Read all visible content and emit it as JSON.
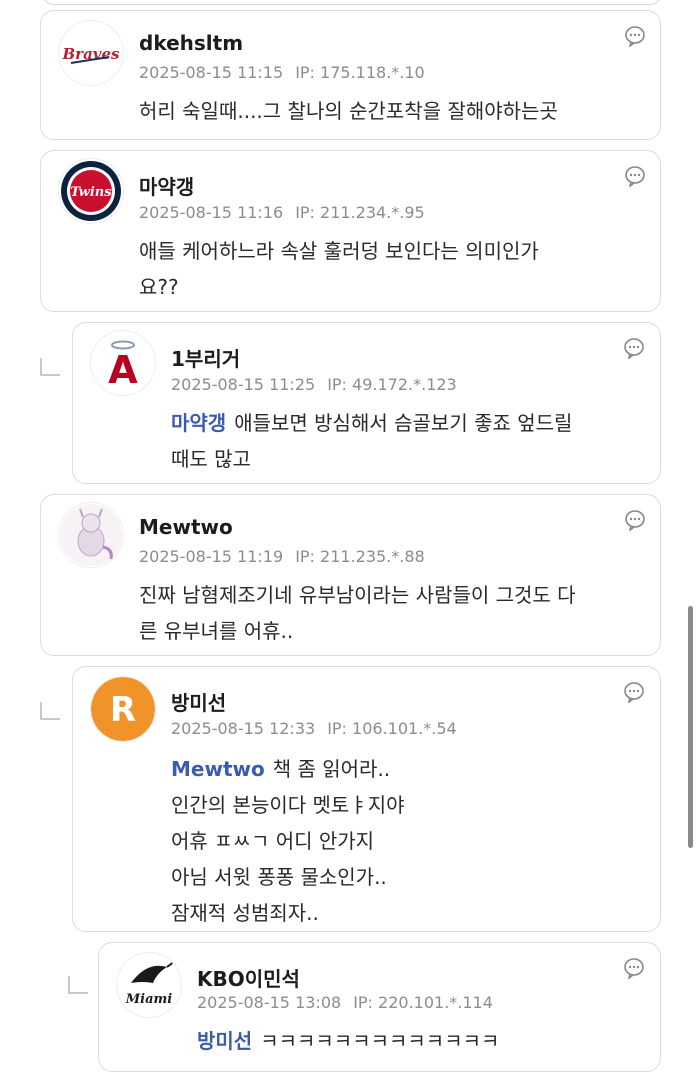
{
  "comments": [
    {
      "username": "dkehsltm",
      "datetime": "2025-08-15 11:15",
      "ip": "IP: 175.118.*.10",
      "text_lines": [
        "허리 숙일때....그 찰나의 순간포착을 잘해야하는곳"
      ],
      "avatar": {
        "icon": "braves-logo-icon",
        "logo_text": "Braves"
      }
    },
    {
      "username": "마약갱",
      "datetime": "2025-08-15 11:16",
      "ip": "IP: 211.234.*.95",
      "text_lines": [
        "애들 케어하느라 속살 훌러덩 보인다는 의미인가",
        "요??"
      ],
      "avatar": {
        "icon": "twins-logo-icon",
        "logo_text": "Twins"
      }
    },
    {
      "username": "1부리거",
      "datetime": "2025-08-15 11:25",
      "ip": "IP: 49.172.*.123",
      "mention": "마약갱",
      "text_lines": [
        "애들보면 방심해서 슴골보기 좋죠 엎드릴",
        "때도 많고"
      ],
      "avatar": {
        "icon": "angels-logo-icon",
        "logo_text": "A"
      }
    },
    {
      "username": "Mewtwo",
      "datetime": "2025-08-15 11:19",
      "ip": "IP: 211.235.*.88",
      "text_lines": [
        "진짜 남혐제조기네 유부남이라는 사람들이 그것도 다",
        "른 유부녀를 어휴.."
      ],
      "avatar": {
        "icon": "mewtwo-avatar-icon"
      }
    },
    {
      "username": "방미선",
      "datetime": "2025-08-15 12:33",
      "ip": "IP: 106.101.*.54",
      "mention": "Mewtwo",
      "text_lines": [
        "책 좀 읽어라..",
        "인간의 본능이다 멧토ㅑ지야",
        "어휴 ㅍㅆㄱ 어디 안가지",
        "아님 서윗 퐁퐁 물소인가..",
        "잠재적 성범죄자.."
      ],
      "avatar": {
        "icon": "letter-r-avatar-icon",
        "logo_text": "R",
        "color": "#F0942A"
      }
    },
    {
      "username": "KBO이민석",
      "datetime": "2025-08-15 13:08",
      "ip": "IP: 220.101.*.114",
      "mention": "방미선",
      "text_lines": [
        "ㅋㅋㅋㅋㅋㅋㅋㅋㅋㅋㅋㅋㅋ"
      ],
      "avatar": {
        "icon": "marlins-logo-icon",
        "logo_text": "Miami"
      }
    }
  ],
  "colors": {
    "mention": "#3b5bb0",
    "meta": "#8c8c8c",
    "border": "#dcdcdc"
  }
}
